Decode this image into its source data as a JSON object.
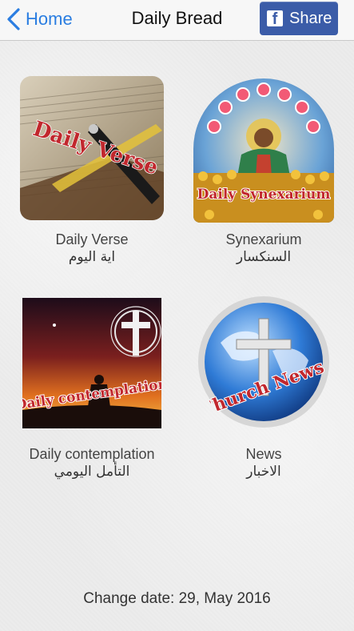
{
  "nav": {
    "back_label": "Home",
    "title": "Daily Bread",
    "share_label": "Share",
    "share_icon": "facebook-icon",
    "accent": "#2a7de1",
    "share_bg": "#3b5ca8"
  },
  "tiles": [
    {
      "label": "Daily Verse",
      "label_ar": "اية اليوم",
      "banner": "Daily Verse"
    },
    {
      "label": "Synexarium",
      "label_ar": "السنكسار",
      "banner": "Daily Synexarium"
    },
    {
      "label": "Daily contemplation",
      "label_ar": "التأمل اليومي",
      "banner": "Daily contemplation"
    },
    {
      "label": "News",
      "label_ar": "الاخبار",
      "banner": "Church News"
    }
  ],
  "footer": {
    "change_date": "Change date: 29, May 2016"
  }
}
